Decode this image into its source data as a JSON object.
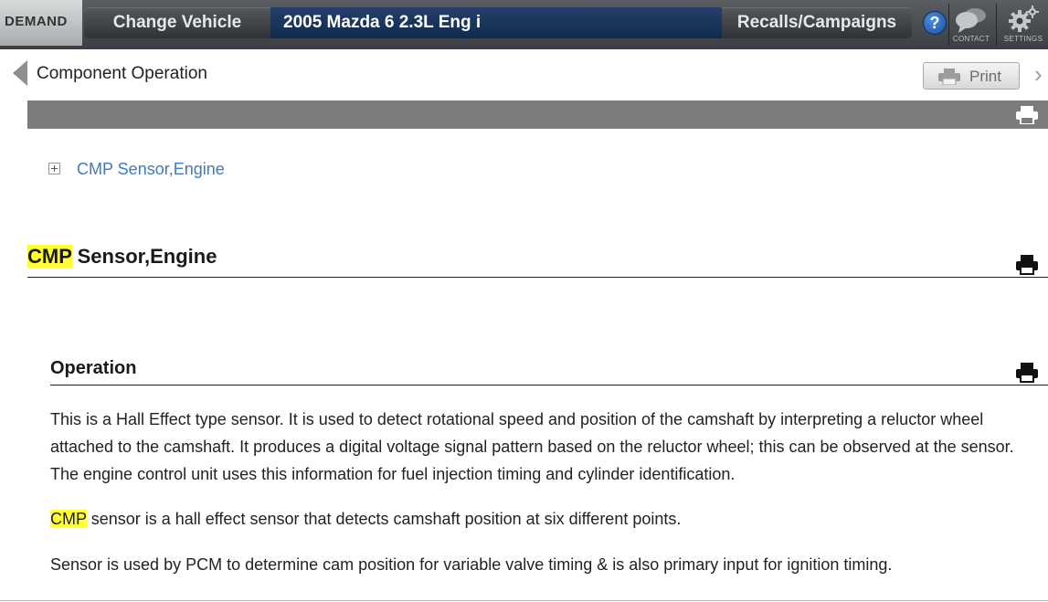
{
  "header": {
    "logo_text": "DEMAND",
    "change_vehicle_label": "Change Vehicle",
    "vehicle": "2005 Mazda 6 2.3L Eng i",
    "recalls_label": "Recalls/Campaigns",
    "help_label": "?",
    "contact_label": "CONTACT",
    "settings_label": "SETTINGS"
  },
  "subheader": {
    "title": "Component Operation",
    "print_label": "Print"
  },
  "tree": {
    "link_label": "CMP Sensor,Engine"
  },
  "article": {
    "title_highlight": "CMP",
    "title_rest": " Sensor,Engine",
    "section_title": "Operation",
    "para1": "This is a Hall Effect type sensor. It is used to detect rotational speed and position of the camshaft by interpreting a reluctor wheel attached to the camshaft. It produces a digital voltage signal pattern based on the reluctor wheel; this can be observed at the sensor. The engine control unit uses this information for fuel injection timing and cylinder identification.",
    "para2_highlight": "CMP",
    "para2_rest": " sensor is a hall effect sensor that detects camshaft position at six different points.",
    "para3": "Sensor is used by PCM to determine cam position for variable valve timing & is also primary input for ignition timing."
  },
  "colors": {
    "highlight": "#ffff33",
    "link": "#3f7bbd",
    "vehicle_field": "#1a355c"
  },
  "icons": [
    "help-icon",
    "chat-icon",
    "gear-icon",
    "printer-icon",
    "plus-box-icon",
    "chevron-left-icon",
    "chevron-right-icon"
  ]
}
